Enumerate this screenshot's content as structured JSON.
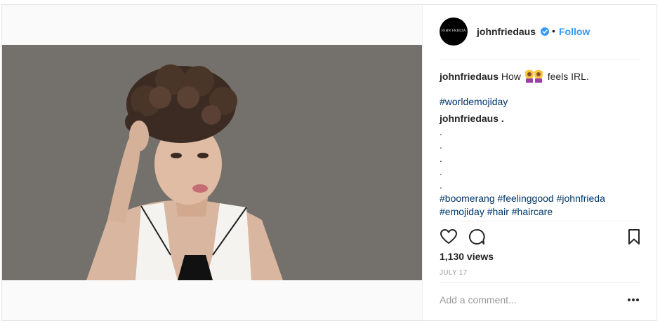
{
  "post": {
    "username": "johnfriedaus",
    "avatar_text": "JOHN FRIEDA",
    "follow_label": "Follow",
    "separator": "•",
    "caption": {
      "username": "johnfriedaus",
      "text_before": "How",
      "emoji_name": "two-women-hands-over-head-emoji",
      "text_after": "feels IRL.",
      "hashtag": "#worldemojiday"
    },
    "comment": {
      "username": "johnfriedaus",
      "text": ".",
      "dots": [
        ".",
        ".",
        ".",
        ".",
        "."
      ],
      "hashtags_line1": [
        "#boomerang",
        "#feelinggood",
        "#johnfrieda"
      ],
      "hashtags_line2": [
        "#emojiday",
        "#hair",
        "#haircare"
      ]
    },
    "views": "1,130 views",
    "date": "JULY 17",
    "add_comment_placeholder": "Add a comment..."
  },
  "icons": [
    "verified-badge-icon",
    "heart-icon",
    "comment-icon",
    "bookmark-icon",
    "more-options-icon"
  ],
  "colors": {
    "link": "#3897f0",
    "hashtag": "#003569",
    "muted": "#999999",
    "photo_bg": "#74706b"
  }
}
